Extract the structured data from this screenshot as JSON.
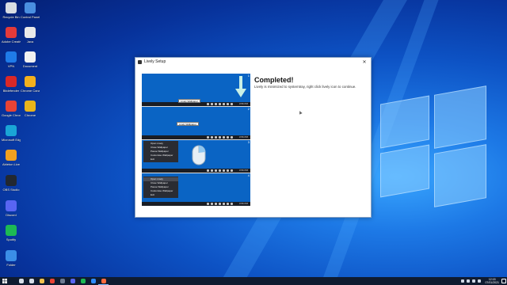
{
  "desktop": {
    "icons": [
      {
        "label": "Recycle Bin",
        "icon": "recycle-bin-icon",
        "color": "#d9dde3"
      },
      {
        "label": "Control Panel",
        "icon": "control-panel-icon",
        "color": "#4a8fe0"
      },
      {
        "label": "Adobe Creative Cloud",
        "icon": "creative-cloud-icon",
        "color": "#e33a3a"
      },
      {
        "label": "Java",
        "icon": "java-icon",
        "color": "#e9e9e9"
      },
      {
        "label": "VPN",
        "icon": "vpn-icon",
        "color": "#1f7be8"
      },
      {
        "label": "Document",
        "icon": "document-icon",
        "color": "#f1f1f1"
      },
      {
        "label": "Bitdefender",
        "icon": "bitdefender-icon",
        "color": "#d82828"
      },
      {
        "label": "Chrome Canary",
        "icon": "chrome-canary-icon",
        "color": "#f2b01e"
      },
      {
        "label": "Google Chrome",
        "icon": "chrome-icon",
        "color": "#e84335"
      },
      {
        "label": "Chrome",
        "icon": "chrome-icon-2",
        "color": "#e9b51b"
      },
      {
        "label": "Microsoft Edge",
        "icon": "edge-icon",
        "color": "#1aa5d6"
      },
      {
        "label": "Ableton Live",
        "icon": "app-icon",
        "color": "#f0a020"
      },
      {
        "label": "OBS Studio",
        "icon": "obs-icon",
        "color": "#222831"
      },
      {
        "label": "Discord",
        "icon": "discord-icon",
        "color": "#5865f2"
      },
      {
        "label": "Spotify",
        "icon": "spotify-icon",
        "color": "#1db954"
      },
      {
        "label": "Folder",
        "icon": "folder-icon",
        "color": "#3b8ee6"
      }
    ]
  },
  "dialog": {
    "title": "Lively Setup",
    "close_glyph": "✕",
    "heading": "Completed!",
    "description": "Lively is minimized to systemtray, right click lively icon to continue.",
    "guide": {
      "steps": [
        "1",
        "2",
        "3",
        "4"
      ],
      "tooltip_1": "Lively Wallpaper",
      "tooltip_2": "Lively Wallpaper",
      "clock": "3:56 PM",
      "lang": "ENG",
      "menu_items": [
        "Open Lively",
        "Close Wallpaper",
        "Pause Wallpaper",
        "Customise Wallpaper",
        "Exit"
      ]
    }
  },
  "taskbar": {
    "start_icon": "windows-start-icon",
    "apps": [
      {
        "name": "search-icon",
        "color": "#d6dde8"
      },
      {
        "name": "task-view-icon",
        "color": "#d6dde8"
      },
      {
        "name": "file-explorer-icon",
        "color": "#f2c14e"
      },
      {
        "name": "chrome-taskbar-icon",
        "color": "#e84335"
      },
      {
        "name": "settings-taskbar-icon",
        "color": "#6c7a91"
      },
      {
        "name": "discord-taskbar-icon",
        "color": "#5865f2"
      },
      {
        "name": "spotify-taskbar-icon",
        "color": "#1db954"
      },
      {
        "name": "store-taskbar-icon",
        "color": "#2d8cff"
      },
      {
        "name": "lively-taskbar-icon",
        "color": "#ff6a3d"
      }
    ],
    "clock_time": "12:15",
    "clock_date": "07/01/2021"
  }
}
